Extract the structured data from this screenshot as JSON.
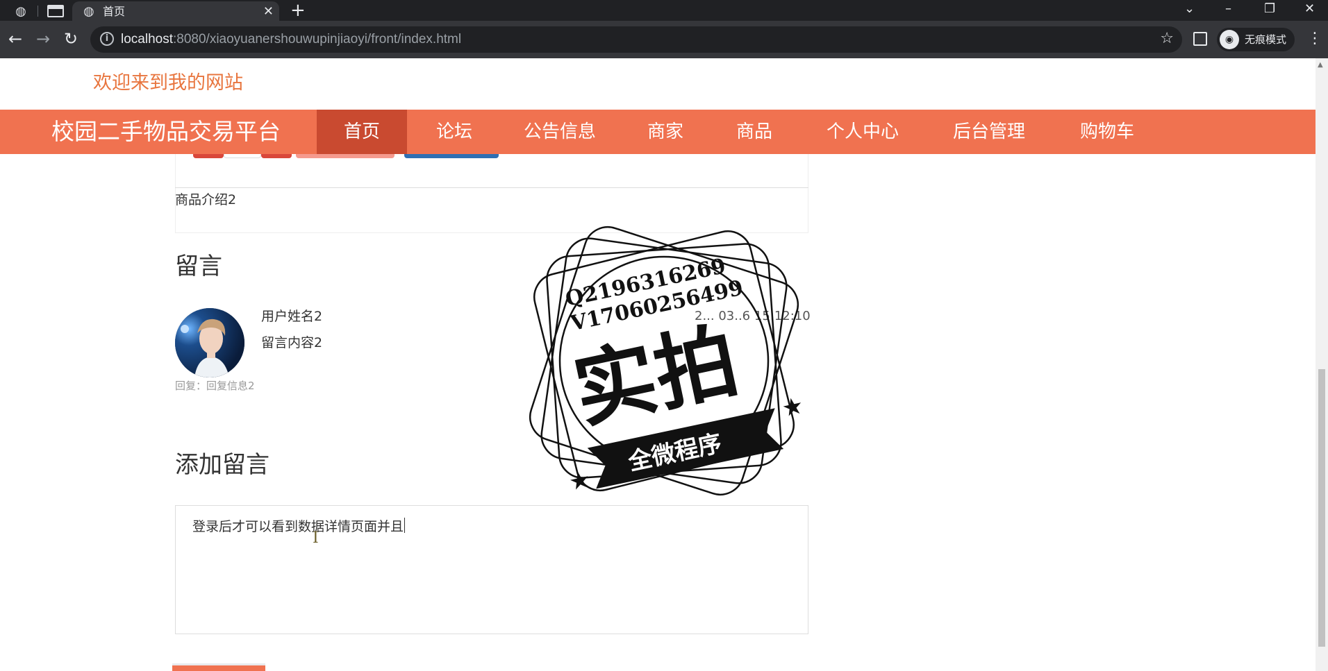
{
  "browser": {
    "tab_title": "首页",
    "url_host": "localhost",
    "url_rest": ":8080/xiaoyuanershouwupinjiaoyi/front/index.html",
    "incognito_label": "无痕模式"
  },
  "page": {
    "welcome": "欢迎来到我的网站",
    "brand": "校园二手物品交易平台",
    "nav": [
      "首页",
      "论坛",
      "公告信息",
      "商家",
      "商品",
      "个人中心",
      "后台管理",
      "购物车"
    ],
    "product_intro": "商品介绍2",
    "comments_heading": "留言",
    "comment": {
      "user": "用户姓名2",
      "time": "2... 03..6 15:12:10",
      "content": "留言内容2",
      "reply": "回复：回复信息2"
    },
    "add_heading": "添加留言",
    "textarea_value": "登录后才可以看到数据详情页面并且"
  },
  "watermark": {
    "line1": "Q2196316269",
    "line2": "V17060256499",
    "big": "实拍",
    "banner": "全微程序"
  },
  "colors": {
    "nav_bg": "#f07250",
    "nav_active": "#c94a30",
    "welcome": "#e8753e"
  }
}
